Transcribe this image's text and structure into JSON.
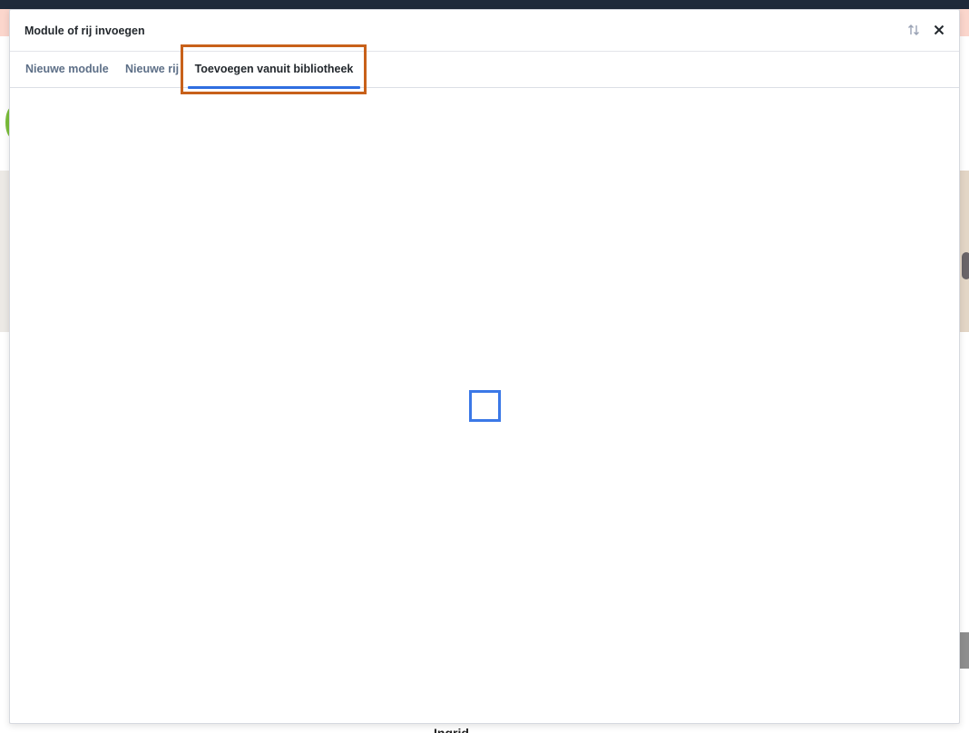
{
  "modal": {
    "title": "Module of rij invoegen",
    "icons": {
      "sort": "sort-arrows-icon",
      "close": "close-icon"
    }
  },
  "tabs": [
    {
      "label": "Nieuwe module",
      "active": false
    },
    {
      "label": "Nieuwe rij",
      "active": false
    },
    {
      "label": "Toevoegen vanuit bibliotheek",
      "active": true
    }
  ],
  "background": {
    "name": "Ingrid"
  },
  "colors": {
    "accent": "#2f6ee0",
    "highlight": "#c8611a",
    "topbar": "#1f2a3a",
    "tab_inactive": "#5d6f87"
  }
}
